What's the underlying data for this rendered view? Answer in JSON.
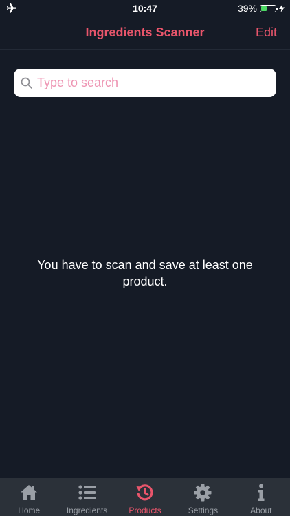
{
  "colors": {
    "background": "#151b26",
    "accent": "#e8556b",
    "tab_bar": "#2b3139",
    "inactive_tab": "#9a9fa6",
    "placeholder": "#ee95b3",
    "battery_fill": "#4cd964",
    "text": "#ffffff"
  },
  "status_bar": {
    "mode_icon": "airplane-icon",
    "time": "10:47",
    "battery_percent": "39%",
    "battery_level": 0.39,
    "charging_icon": "lightning-bolt-icon"
  },
  "nav": {
    "title": "Ingredients Scanner",
    "edit_label": "Edit"
  },
  "search": {
    "placeholder": "Type to search",
    "value": "",
    "icon": "search-icon"
  },
  "empty_state": {
    "message": "You have to scan and save at least one product."
  },
  "tabs": [
    {
      "label": "Home",
      "icon": "home-icon",
      "active": false
    },
    {
      "label": "Ingredients",
      "icon": "list-icon",
      "active": false
    },
    {
      "label": "Products",
      "icon": "history-icon",
      "active": true
    },
    {
      "label": "Settings",
      "icon": "gear-icon",
      "active": false
    },
    {
      "label": "About",
      "icon": "info-icon",
      "active": false
    }
  ]
}
